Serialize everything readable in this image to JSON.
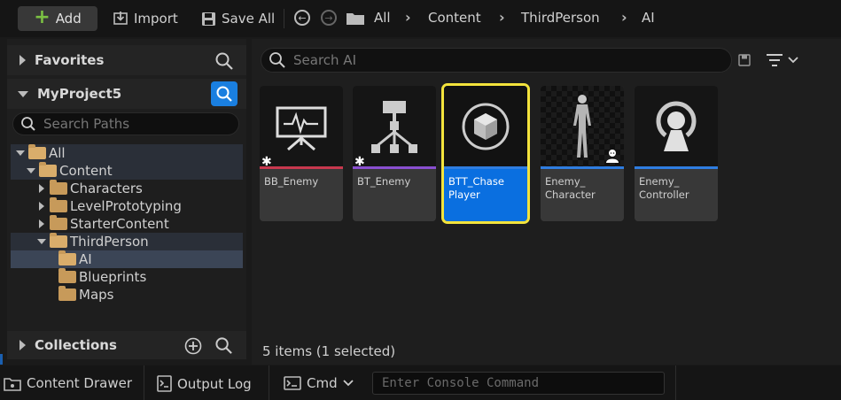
{
  "toolbar": {
    "add_label": "Add",
    "import_label": "Import",
    "save_all_label": "Save All",
    "breadcrumb": [
      "All",
      "Content",
      "ThirdPerson",
      "AI"
    ]
  },
  "left_panel": {
    "favorites_label": "Favorites",
    "project_label": "MyProject5",
    "search_paths_placeholder": "Search Paths",
    "tree": [
      {
        "label": "All"
      },
      {
        "label": "Content"
      },
      {
        "label": "Characters"
      },
      {
        "label": "LevelPrototyping"
      },
      {
        "label": "StarterContent"
      },
      {
        "label": "ThirdPerson"
      },
      {
        "label": "AI"
      },
      {
        "label": "Blueprints"
      },
      {
        "label": "Maps"
      }
    ],
    "collections_label": "Collections"
  },
  "content": {
    "search_placeholder": "Search AI",
    "assets": [
      {
        "label": "BB_Enemy",
        "accent": "#c8384e",
        "selected": false
      },
      {
        "label": "BT_Enemy",
        "accent": "#8a4fd0",
        "selected": false
      },
      {
        "label": "BTT_Chase Player",
        "accent": "#2f7de0",
        "selected": true
      },
      {
        "label": "Enemy_ Character",
        "accent": "#2f7de0",
        "selected": false
      },
      {
        "label": "Enemy_ Controller",
        "accent": "#2f7de0",
        "selected": false
      }
    ],
    "status": "5 items (1 selected)"
  },
  "bottom_bar": {
    "content_drawer_label": "Content Drawer",
    "output_log_label": "Output Log",
    "cmd_label": "Cmd",
    "console_placeholder": "Enter Console Command"
  },
  "colors": {
    "selection_outline": "#f3e33c",
    "selection_fill": "#0a6fe0",
    "add_plus": "#7bc043",
    "folder": "#c79a5a"
  }
}
